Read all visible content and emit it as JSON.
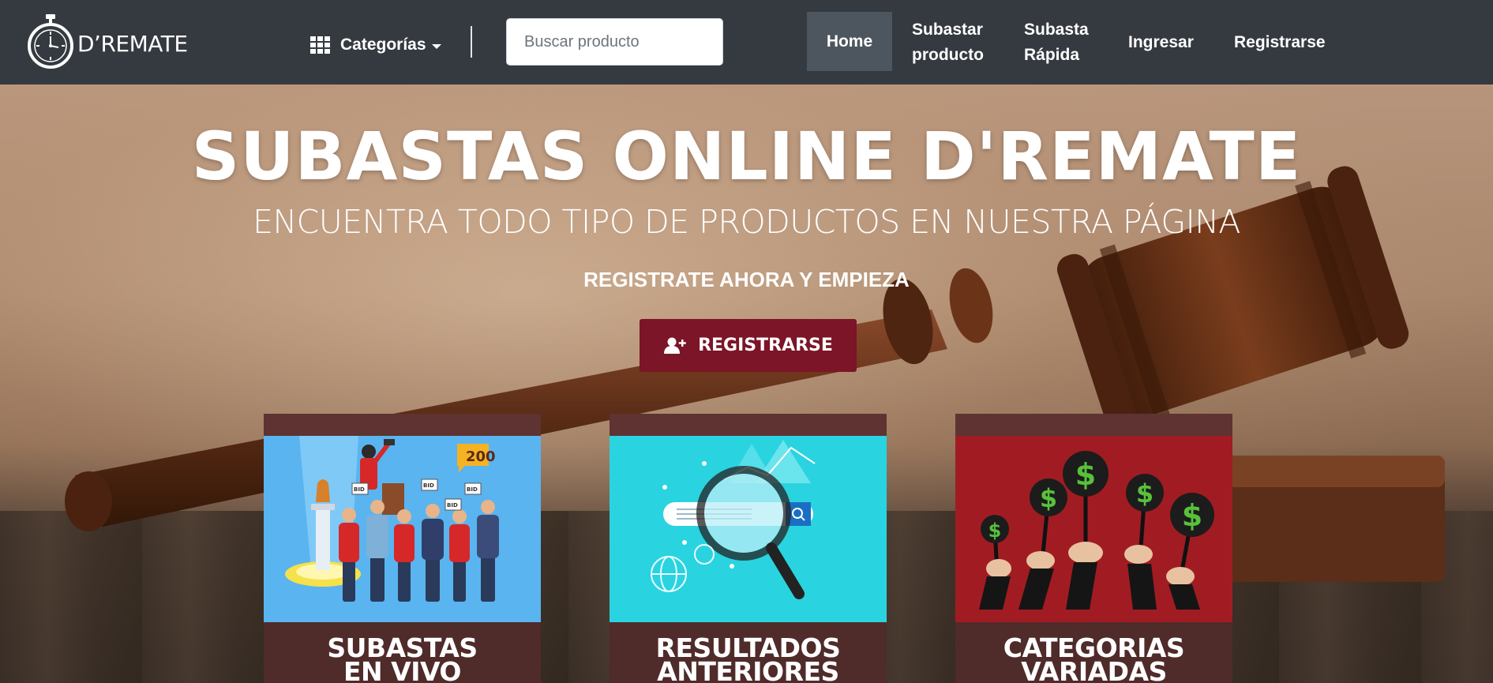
{
  "brand": {
    "name": "D’REMATE"
  },
  "header": {
    "categories_label": "Categorías",
    "search_placeholder": "Buscar producto",
    "nav": {
      "home": "Home",
      "subastar_line1": "Subastar",
      "subastar_line2": "producto",
      "rapida_line1": "Subasta",
      "rapida_line2": "Rápida",
      "ingresar": "Ingresar",
      "registrarse": "Registrarse"
    }
  },
  "hero": {
    "title": "SUBASTAS ONLINE D'REMATE",
    "subtitle": "ENCUENTRA TODO TIPO DE PRODUCTOS EN NUESTRA PÁGINA",
    "cta_text": "REGISTRATE AHORA Y EMPIEZA",
    "button_label": "REGISTRARSE"
  },
  "cards": [
    {
      "title_line1": "SUBASTAS",
      "title_line2": "EN VIVO",
      "bid_badge": "200",
      "bid_tag": "BID"
    },
    {
      "title_line1": "RESULTADOS",
      "title_line2": "ANTERIORES"
    },
    {
      "title_line1": "CATEGORIAS",
      "title_line2": "VARIADAS",
      "sign_symbol": "$"
    }
  ],
  "colors": {
    "navbar": "#343a40",
    "nav_active": "#4d565f",
    "primary_button": "#7b1527",
    "card_bg": "#4f2b2a"
  }
}
